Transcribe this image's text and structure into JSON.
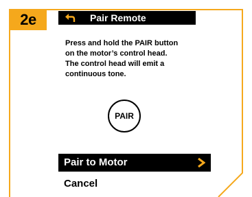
{
  "step_badge": "2e",
  "screen": {
    "title": "Pair Remote",
    "message_lines": [
      "Press and hold the PAIR button",
      "on the motor’s control head.",
      "The control head will emit a",
      "continuous tone."
    ],
    "pair_button_label": "PAIR"
  },
  "menu": {
    "pair_to_motor": "Pair to Motor",
    "cancel": "Cancel"
  },
  "colors": {
    "accent": "#f5a81c",
    "bar_background": "#000000",
    "bar_text": "#ffffff"
  },
  "icons": {
    "back": "back-arrow-icon",
    "next": "chevron-right-icon"
  }
}
